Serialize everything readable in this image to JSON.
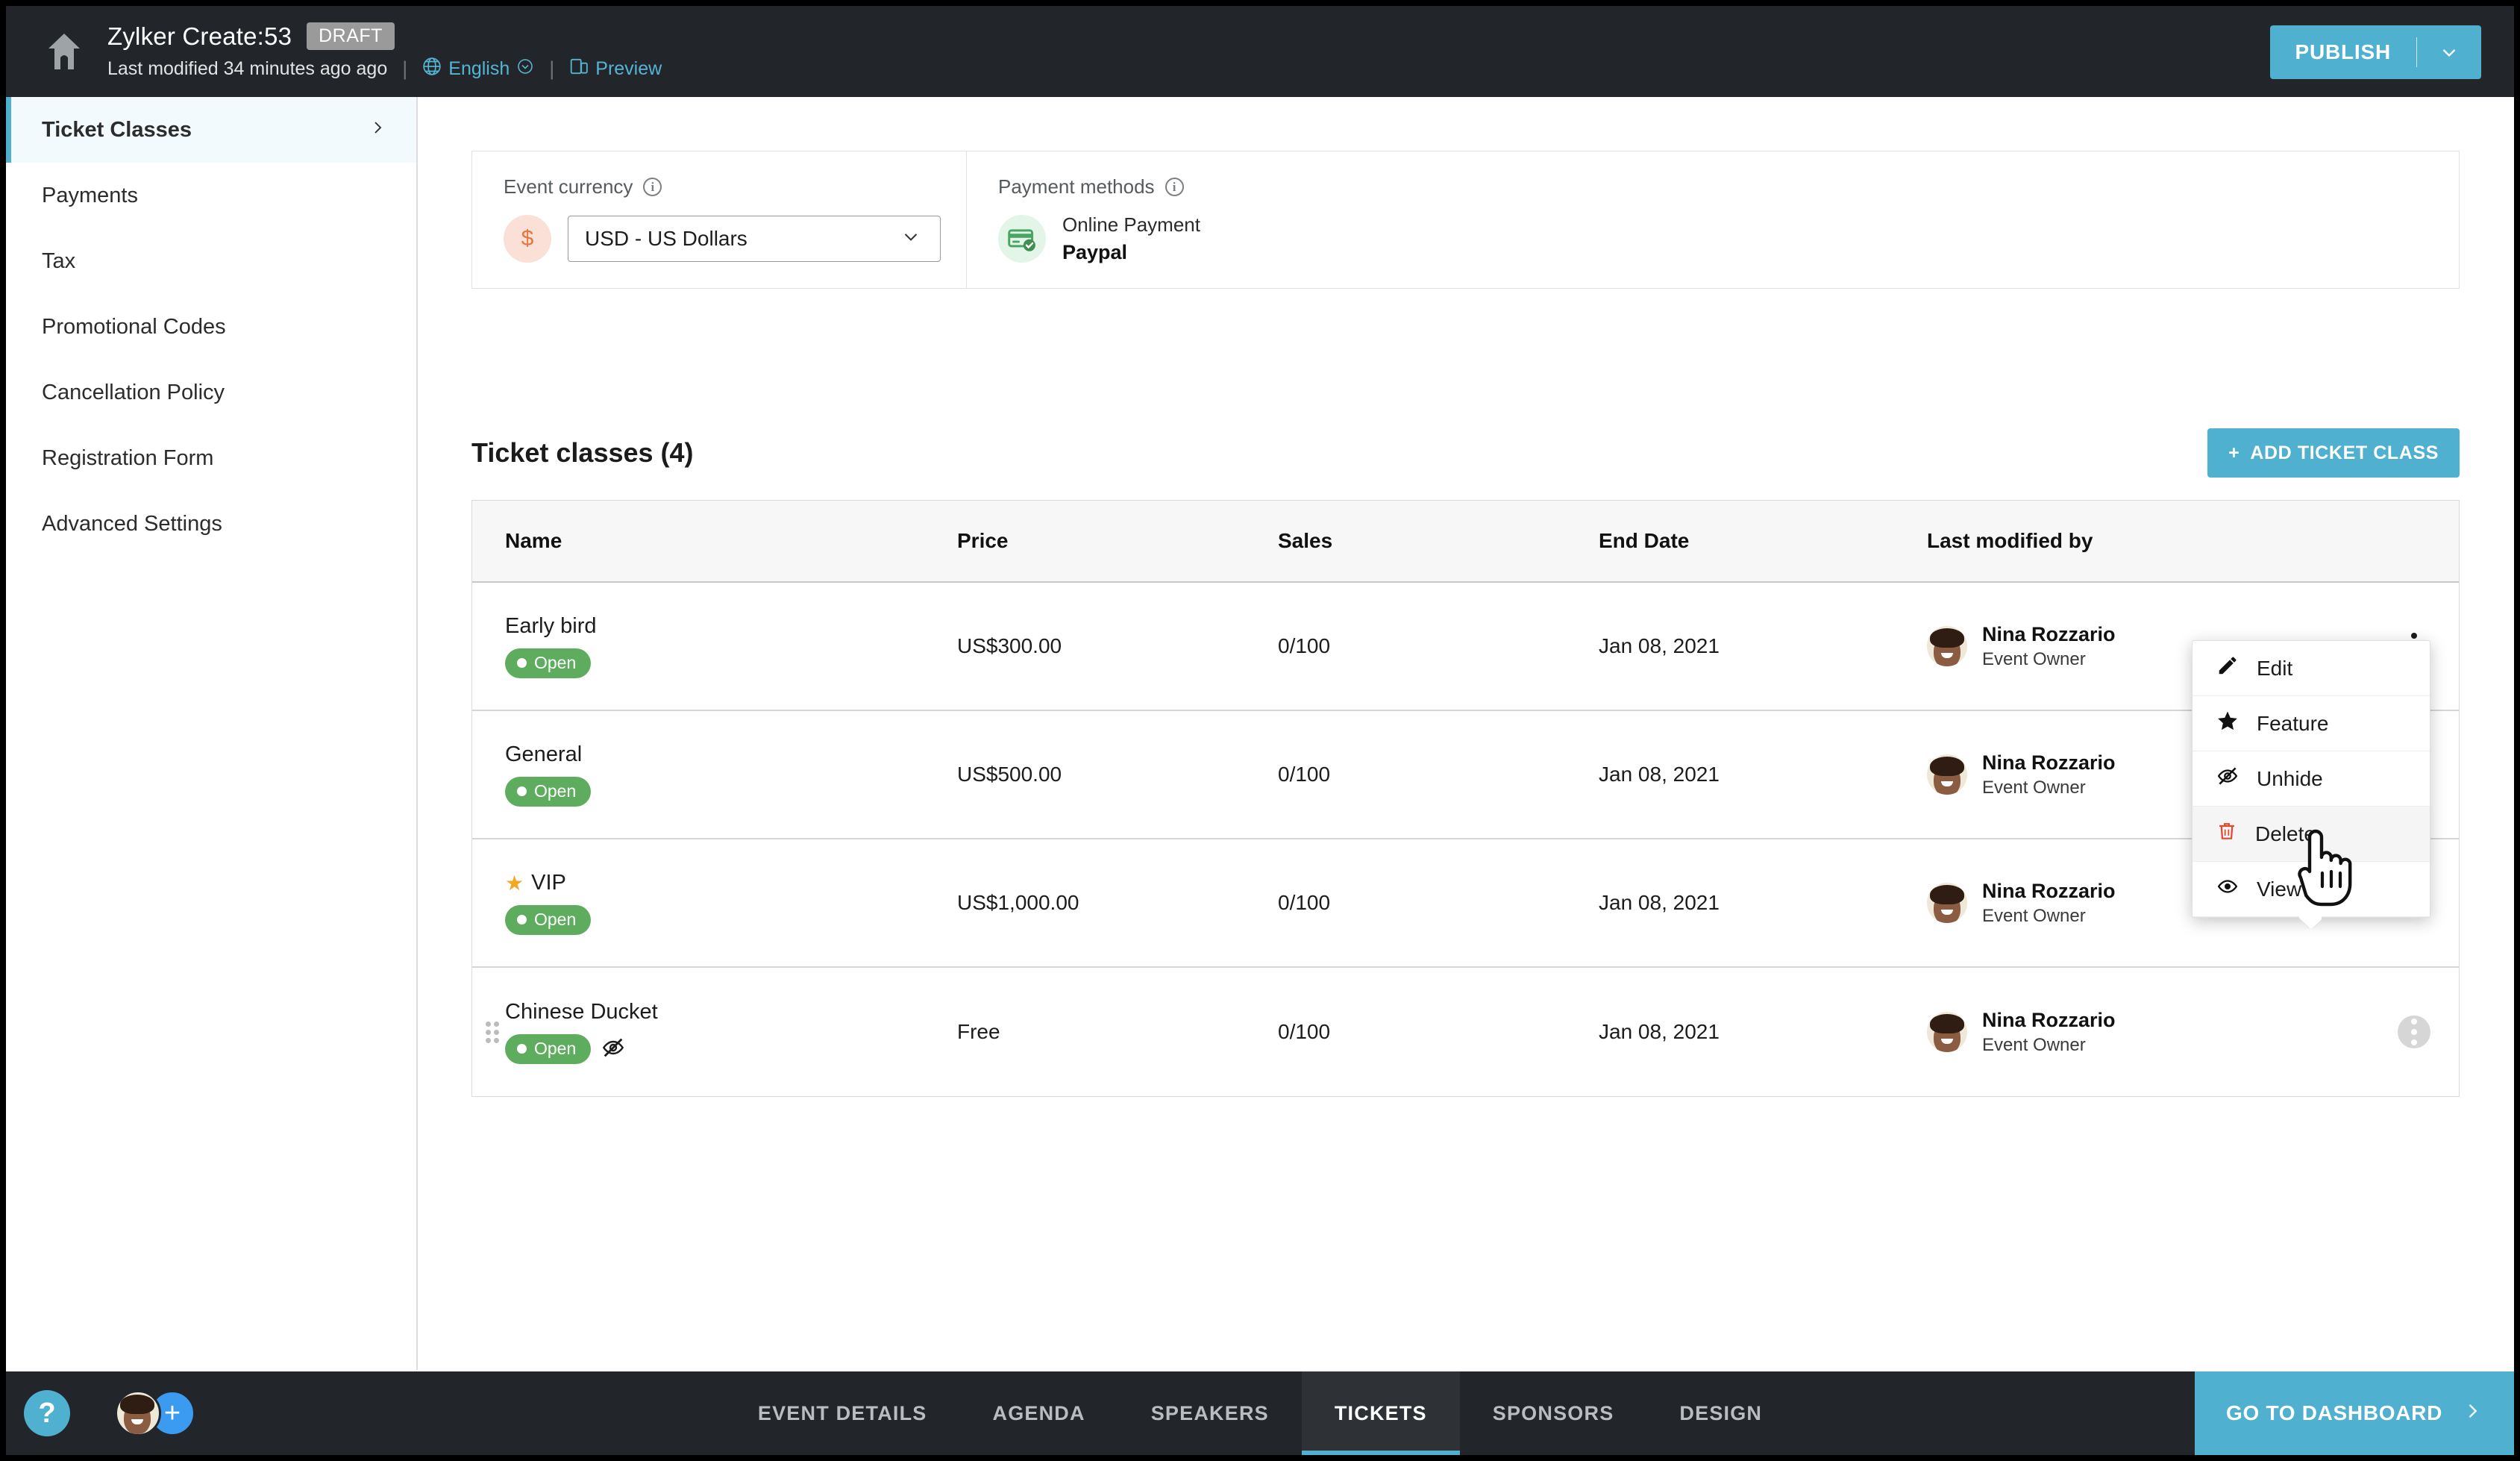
{
  "header": {
    "home_icon": "home-icon",
    "event_title": "Zylker Create:53",
    "status_badge": "DRAFT",
    "last_modified": "Last modified 34 minutes ago ago",
    "separator": "|",
    "language": "English",
    "preview": "Preview",
    "publish_label": "PUBLISH"
  },
  "sidebar": {
    "items": [
      {
        "label": "Ticket Classes",
        "active": true,
        "chevron": "›"
      },
      {
        "label": "Payments",
        "active": false
      },
      {
        "label": "Tax",
        "active": false
      },
      {
        "label": "Promotional Codes",
        "active": false
      },
      {
        "label": "Cancellation Policy",
        "active": false
      },
      {
        "label": "Registration Form",
        "active": false
      },
      {
        "label": "Advanced Settings",
        "active": false
      }
    ]
  },
  "currency_card": {
    "label": "Event currency",
    "symbol": "$",
    "selected": "USD - US Dollars"
  },
  "payments_card": {
    "label": "Payment methods",
    "method_type": "Online Payment",
    "method_name": "Paypal"
  },
  "section": {
    "title": "Ticket classes (4)",
    "add_button": "ADD TICKET CLASS",
    "add_button_plus": "+"
  },
  "table": {
    "columns": [
      "Name",
      "Price",
      "Sales",
      "End Date",
      "Last modified by"
    ],
    "rows": [
      {
        "name": "Early bird",
        "featured": false,
        "hidden": false,
        "draggable": false,
        "status": "Open",
        "price": "US$300.00",
        "sales": "0/100",
        "end_date": "Jan 08, 2021",
        "modified_by": "Nina Rozzario",
        "modified_role": "Event Owner",
        "menu_open": false
      },
      {
        "name": "General",
        "featured": false,
        "hidden": false,
        "draggable": false,
        "status": "Open",
        "price": "US$500.00",
        "sales": "0/100",
        "end_date": "Jan 08, 2021",
        "modified_by": "Nina Rozzario",
        "modified_role": "Event Owner",
        "menu_open": false
      },
      {
        "name": "VIP",
        "featured": true,
        "hidden": false,
        "draggable": false,
        "status": "Open",
        "price": "US$1,000.00",
        "sales": "0/100",
        "end_date": "Jan 08, 2021",
        "modified_by": "Nina Rozzario",
        "modified_role": "Event Owner",
        "menu_open": false
      },
      {
        "name": "Chinese Ducket",
        "featured": false,
        "hidden": true,
        "draggable": true,
        "status": "Open",
        "price": "Free",
        "sales": "0/100",
        "end_date": "Jan 08, 2021",
        "modified_by": "Nina Rozzario",
        "modified_role": "Event Owner",
        "menu_open": true
      }
    ]
  },
  "context_menu": {
    "items": [
      {
        "label": "Edit",
        "icon": "pencil-icon",
        "highlighted": false
      },
      {
        "label": "Feature",
        "icon": "star-icon",
        "highlighted": false
      },
      {
        "label": "Unhide",
        "icon": "eye-slash-icon",
        "highlighted": false
      },
      {
        "label": "Delete",
        "icon": "trash-icon",
        "highlighted": true
      },
      {
        "label": "View",
        "icon": "eye-icon",
        "highlighted": false
      }
    ]
  },
  "footer": {
    "help": "?",
    "add_person": "+",
    "tabs": [
      {
        "label": "EVENT DETAILS",
        "active": false
      },
      {
        "label": "AGENDA",
        "active": false
      },
      {
        "label": "SPEAKERS",
        "active": false
      },
      {
        "label": "TICKETS",
        "active": true
      },
      {
        "label": "SPONSORS",
        "active": false
      },
      {
        "label": "DESIGN",
        "active": false
      }
    ],
    "dashboard_button": "GO TO DASHBOARD"
  },
  "colors": {
    "accent": "#4fb0d0",
    "dark": "#22262b",
    "status_green": "#5ead5e",
    "delete_red": "#e0492b",
    "star_orange": "#f5a623"
  }
}
